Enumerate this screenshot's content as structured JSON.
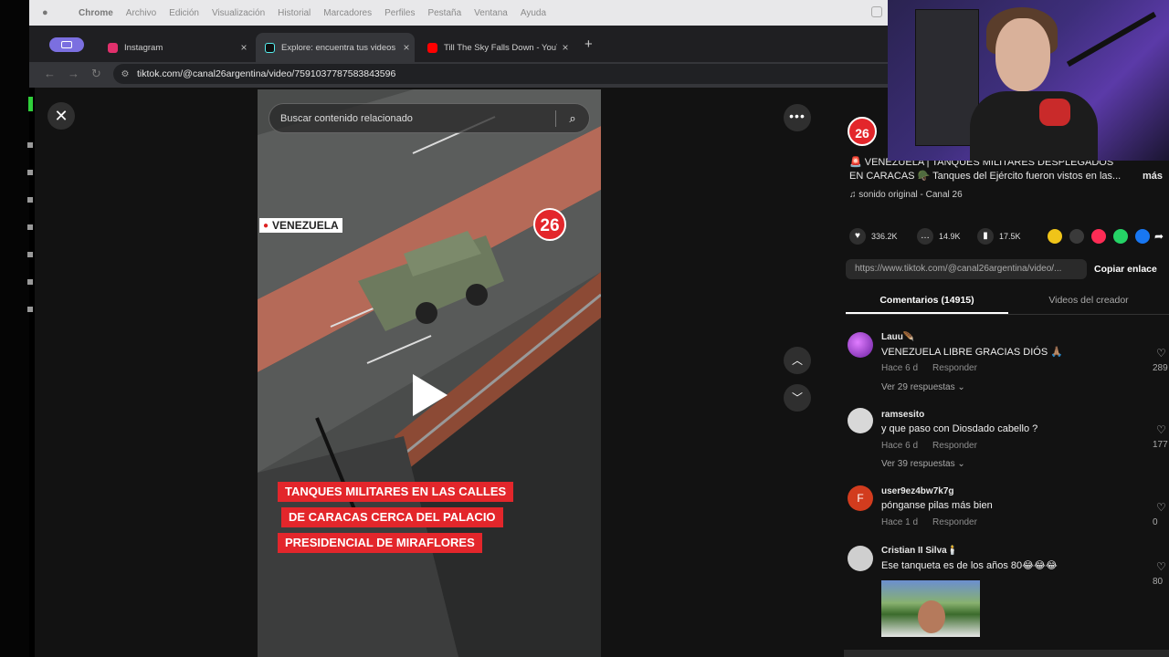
{
  "menubar": {
    "app": "Chrome",
    "items": [
      "Archivo",
      "Edición",
      "Visualización",
      "Historial",
      "Marcadores",
      "Perfiles",
      "Pestaña",
      "Ventana",
      "Ayuda"
    ]
  },
  "tabs": [
    {
      "title": "Instagram",
      "color": "#e1306c"
    },
    {
      "title": "Explore: encuentra tus videos",
      "color": "#111111"
    },
    {
      "title": "Till The Sky Falls Down - YouTube",
      "color": "#ff0000"
    }
  ],
  "address": {
    "url": "tiktok.com/@canal26argentina/video/7591037787583843596"
  },
  "video": {
    "search_placeholder": "Buscar contenido relacionado",
    "location": "VENEZUELA",
    "logo": "26",
    "caption": [
      "TANQUES MILITARES EN LAS CALLES",
      "DE CARACAS CERCA DEL PALACIO",
      "PRESIDENCIAL DE MIRAFLORES"
    ]
  },
  "post": {
    "avatar_text": "26",
    "description": "🚨 VENEZUELA | TANQUES MILITARES DESPLEGADOS EN CARACAS 🪖 Tanques del Ejército fueron vistos en las...",
    "more": "más",
    "sound": "♫ sonido original - Canal 26",
    "likes": "336.2K",
    "comments": "14.9K",
    "saves": "17.5K",
    "link": "https://www.tiktok.com/@canal26argentina/video/...",
    "copy_link": "Copiar enlace",
    "tab_comments": "Comentarios (14915)",
    "tab_creator": "Videos del creador"
  },
  "comments": [
    {
      "user": "Lauu🪶",
      "text": "VENEZUELA LIBRE GRACIAS DIÓS 🙏🏽",
      "time": "Hace 6 d",
      "reply": "Responder",
      "replies": "Ver 29 respuestas ⌄",
      "likes": "289",
      "avatar_color": "#8a2be2"
    },
    {
      "user": "ramsesito",
      "text": "y que paso con Diosdado cabello ?",
      "time": "Hace 6 d",
      "reply": "Responder",
      "replies": "Ver 39 respuestas ⌄",
      "likes": "177",
      "avatar_color": "#d8d8d8"
    },
    {
      "user": "user9ez4bw7k7g",
      "text": "pónganse pilas más bien",
      "time": "Hace 1 d",
      "reply": "Responder",
      "replies": "",
      "likes": "0",
      "avatar_color": "#d23c1e",
      "avatar_letter": "F"
    },
    {
      "user": "Cristian II Silva🕯️",
      "text": "Ese tanqueta es de los años 80😂😂😂",
      "time": "",
      "reply": "",
      "replies": "",
      "likes": "80",
      "avatar_color": "#cfcfcf"
    }
  ]
}
